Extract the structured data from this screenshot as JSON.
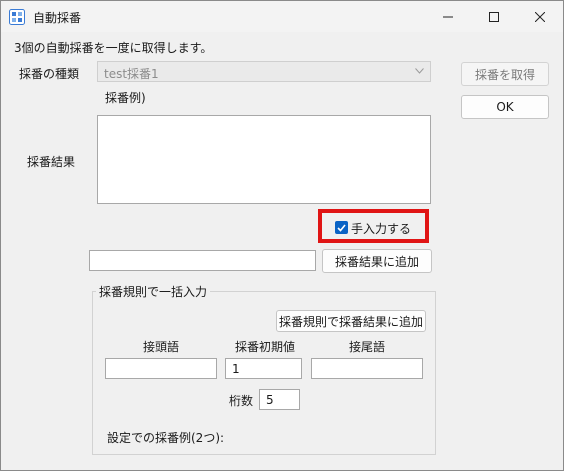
{
  "window": {
    "title": "自動採番",
    "icon": "app-grid-icon",
    "controls": {
      "minimize": "minimize-icon",
      "maximize": "maximize-icon",
      "close": "close-icon"
    }
  },
  "description": "3個の自動採番を一度に取得します。",
  "type_label": "採番の種類",
  "type_value": "test採番1",
  "example_label": "採番例)",
  "result_label": "採番結果",
  "result_value": "",
  "get_button": "採番を取得",
  "ok_button": "OK",
  "manual_checkbox": {
    "label": "手入力する",
    "checked": true
  },
  "manual_input_value": "",
  "add_result_button": "採番結果に追加",
  "bulk_group": {
    "title": "採番規則で一括入力",
    "add_by_rule_button": "採番規則で採番結果に追加",
    "prefix_label": "接頭語",
    "prefix_value": "",
    "initial_label": "採番初期値",
    "initial_value": "1",
    "suffix_label": "接尾語",
    "suffix_value": "",
    "digits_label": "桁数",
    "digits_value": "5",
    "example_label": "設定での採番例(2つ):"
  },
  "colors": {
    "highlight": "#e01414",
    "checkbox": "#0b63c5",
    "window_bg": "#f0f0f0"
  }
}
